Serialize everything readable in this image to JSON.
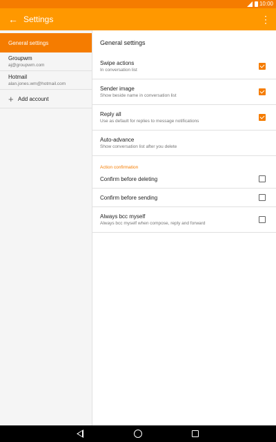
{
  "status": {
    "time": "10:00"
  },
  "app_bar": {
    "title": "Settings",
    "back_icon": "arrow-back-icon",
    "overflow_icon": "more-vert-icon"
  },
  "left_pane": {
    "active": "General settings",
    "accounts": [
      {
        "name": "Groupwm",
        "email": "aj@groupwm.com"
      },
      {
        "name": "Hotmail",
        "email": "alan.jones.wm@hotmail.com"
      }
    ],
    "add_account": "Add account"
  },
  "right_pane": {
    "header": "General settings",
    "rows": [
      {
        "title": "Swipe actions",
        "summary": "In conversation list",
        "checked": true
      },
      {
        "title": "Sender image",
        "summary": "Show beside name in conversation list",
        "checked": true
      },
      {
        "title": "Reply all",
        "summary": "Use as default for replies to message notifications",
        "checked": true
      },
      {
        "title": "Auto-advance",
        "summary": "Show conversation list after you delete"
      }
    ],
    "category": "Action confirmation",
    "confirm_rows": [
      {
        "title": "Confirm before deleting",
        "checked": false
      },
      {
        "title": "Confirm before sending",
        "checked": false
      },
      {
        "title": "Always bcc myself",
        "summary": "Always bcc myself when compose, reply and forward",
        "checked": false
      }
    ]
  },
  "colors": {
    "accent": "#f57c00",
    "app_bar": "#ff9800",
    "status_bar": "#f57c00"
  }
}
